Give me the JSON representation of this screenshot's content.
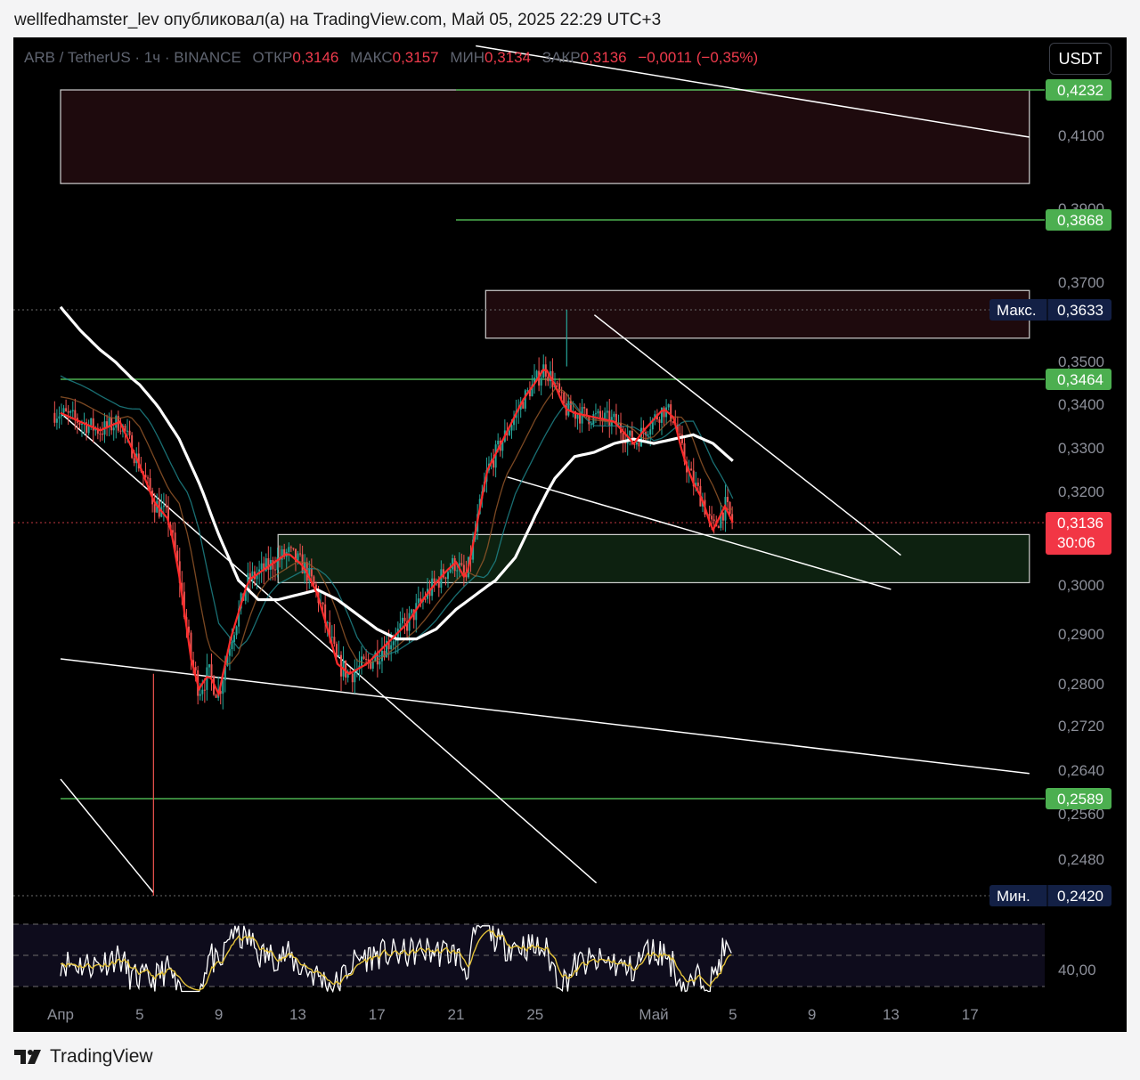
{
  "byline": "wellfedhamster_lev опубликовал(а) на TradingView.com, Май 05, 2025 22:29 UTC+3",
  "legend": {
    "symbol": "ARB / TetherUS · 1ч · BINANCE",
    "open_label": "ОТКР",
    "open": "0,3146",
    "high_label": "МАКС",
    "high": "0,3157",
    "low_label": "МИН",
    "low": "0,3134",
    "close_label": "ЗАКР",
    "close": "0,3136",
    "change": "−0,0011 (−0,35%)"
  },
  "currency_button": "USDT",
  "footer": {
    "brand": "TradingView",
    "logo_icon": "tradingview-logo-icon"
  },
  "colors": {
    "up": "#26a69a",
    "down": "#ef5350",
    "price_line_red": "#ff2a2a",
    "ema_white": "#ffffff",
    "green_level": "#4caf50",
    "supply_zone": "#1e0a0d",
    "demand_zone": "#0d2110",
    "price_tag": "#f23645",
    "extreme_tag": "#132045",
    "rsi_line": "#ffffff",
    "rsi_signal": "#e2c13a"
  },
  "chart_data": {
    "type": "line",
    "symbol": "ARB / TetherUS",
    "interval": "1ч",
    "exchange": "BINANCE",
    "x_ticks": [
      "Апр",
      "5",
      "9",
      "13",
      "17",
      "21",
      "25",
      "Май",
      "5",
      "9",
      "13",
      "17"
    ],
    "x_tick_days": [
      1,
      5,
      9,
      13,
      17,
      21,
      25,
      31,
      35,
      39,
      43,
      47
    ],
    "y_ticks": [
      "0,4100",
      "0,3900",
      "0,3700",
      "0,3500",
      "0,3400",
      "0,3300",
      "0,3200",
      "0,3000",
      "0,2900",
      "0,2800",
      "0,2720",
      "0,2640",
      "0,2560",
      "0,2480"
    ],
    "y_tick_values": [
      0.41,
      0.39,
      0.37,
      0.35,
      0.34,
      0.33,
      0.32,
      0.3,
      0.29,
      0.28,
      0.272,
      0.264,
      0.256,
      0.248
    ],
    "price_path_days": [
      1,
      2,
      3,
      4,
      5,
      5.7,
      6.5,
      7,
      7.6,
      8,
      8.5,
      9,
      9.6,
      10.5,
      11.5,
      12.5,
      13.3,
      14,
      15,
      15.6,
      16.5,
      17.5,
      18.5,
      19.5,
      20.5,
      21,
      21.5,
      22,
      22.6,
      23.5,
      24.5,
      25.5,
      26,
      26.5,
      27,
      28,
      29,
      30,
      30.5,
      31.5,
      32,
      32.5,
      33,
      33.5,
      33.8,
      34,
      34.6,
      35
    ],
    "price_path": [
      0.338,
      0.336,
      0.334,
      0.336,
      0.326,
      0.318,
      0.314,
      0.302,
      0.285,
      0.279,
      0.282,
      0.278,
      0.289,
      0.301,
      0.304,
      0.307,
      0.304,
      0.298,
      0.284,
      0.282,
      0.284,
      0.288,
      0.292,
      0.298,
      0.303,
      0.305,
      0.301,
      0.312,
      0.325,
      0.333,
      0.342,
      0.349,
      0.345,
      0.339,
      0.338,
      0.337,
      0.336,
      0.331,
      0.334,
      0.339,
      0.337,
      0.328,
      0.322,
      0.318,
      0.314,
      0.312,
      0.317,
      0.3136
    ],
    "ema_path_days": [
      1,
      2,
      3,
      4,
      5,
      6,
      7,
      8,
      9,
      10,
      11,
      12,
      13,
      14,
      15,
      16,
      17,
      18,
      19,
      20,
      21,
      22,
      23,
      24,
      25,
      26,
      27,
      28,
      29,
      30,
      31,
      32,
      33,
      34,
      35
    ],
    "ema_path": [
      0.364,
      0.358,
      0.353,
      0.349,
      0.345,
      0.339,
      0.332,
      0.322,
      0.311,
      0.301,
      0.297,
      0.297,
      0.298,
      0.299,
      0.297,
      0.294,
      0.291,
      0.289,
      0.289,
      0.291,
      0.295,
      0.298,
      0.301,
      0.306,
      0.315,
      0.323,
      0.328,
      0.329,
      0.331,
      0.332,
      0.331,
      0.332,
      0.333,
      0.331,
      0.327
    ],
    "levels": [
      {
        "label": "0,4232",
        "value": 0.4232,
        "from_day": 21
      },
      {
        "label": "0,3868",
        "value": 0.3868,
        "from_day": 21
      },
      {
        "label": "0,3464",
        "value": 0.3464,
        "from_day": 1
      },
      {
        "label": "0,2589",
        "value": 0.2589,
        "from_day": 1
      }
    ],
    "zones": [
      {
        "kind": "supply",
        "from_day": 1,
        "to_day": 50,
        "top": 0.4232,
        "bottom": 0.3968
      },
      {
        "kind": "supply",
        "from_day": 22.5,
        "to_day": 50,
        "top": 0.368,
        "bottom": 0.356
      },
      {
        "kind": "demand",
        "from_day": 12,
        "to_day": 50,
        "top": 0.311,
        "bottom": 0.3005
      }
    ],
    "trendlines": [
      {
        "x1": 22,
        "y1": 0.436,
        "x2": 50,
        "y2": 0.4095
      },
      {
        "x1": 1,
        "y1": 0.338,
        "x2": 28.1,
        "y2": 0.2441
      },
      {
        "x1": 1,
        "y1": 0.285,
        "x2": 50,
        "y2": 0.2634
      },
      {
        "x1": 1,
        "y1": 0.2624,
        "x2": 5.7,
        "y2": 0.2425
      },
      {
        "x1": 23.6,
        "y1": 0.3233,
        "x2": 43,
        "y2": 0.2991
      },
      {
        "x1": 28,
        "y1": 0.362,
        "x2": 43.5,
        "y2": 0.3065
      }
    ],
    "extremes": {
      "max_label": "Макс.",
      "max": "0,3633",
      "max_value": 0.3633,
      "min_label": "Мин.",
      "min": "0,2420",
      "min_value": 0.242
    },
    "last_price": {
      "value": 0.3136,
      "label": "0,3136",
      "countdown": "30:06"
    },
    "rsi": {
      "level_label": "40,00",
      "upper": 70,
      "middle": 50,
      "lower": 30
    }
  }
}
